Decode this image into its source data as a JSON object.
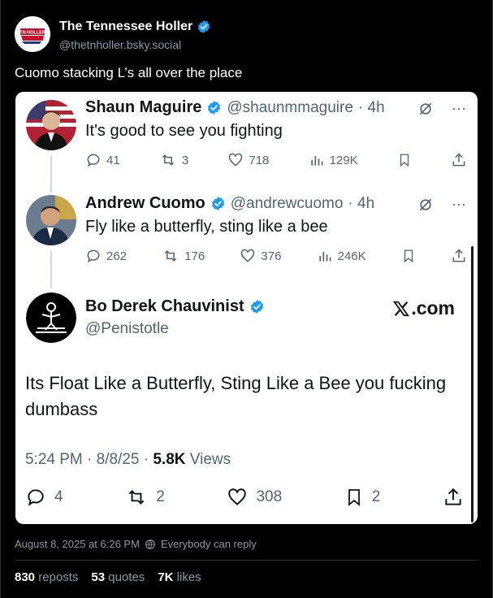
{
  "post": {
    "author_name": "The Tennessee Holler",
    "author_handle": "@thetnholler.bsky.social",
    "avatar_text": "TN HOLLER",
    "text": "Cuomo stacking L’s all over the place",
    "timestamp": "August 8, 2025 at 6:26 PM",
    "reply_setting": "Everybody can reply",
    "stats": {
      "reposts_count": "830",
      "reposts_label": "reposts",
      "quotes_count": "53",
      "quotes_label": "quotes",
      "likes_count": "7K",
      "likes_label": "likes"
    }
  },
  "screenshot": {
    "tweet1": {
      "name": "Shaun Maguire",
      "handle": "@shaunmmaguire",
      "time": "· 4h",
      "text": "It's good to see you fighting",
      "replies": "41",
      "reposts": "3",
      "likes": "718",
      "views": "129K"
    },
    "tweet2": {
      "name": "Andrew Cuomo",
      "handle": "@andrewcuomo",
      "time": "· 4h",
      "text": "Fly like a butterfly, sting like a bee",
      "replies": "262",
      "reposts": "176",
      "likes": "376",
      "views": "246K"
    },
    "quote": {
      "name": "Bo Derek Chauvinist",
      "handle": "@Penistotle",
      "site": ".com",
      "body": "Its Float Like a Butterfly, Sting Like a Bee you fucking dumbass",
      "time": "5:24 PM · 8/8/25 · ",
      "views_count": "5.8K",
      "views_label": " Views",
      "replies": "4",
      "reposts": "2",
      "likes": "308",
      "bookmarks": "2"
    }
  },
  "colors": {
    "verified": "#1d9bf0",
    "background": "#000000",
    "card": "#ffffff"
  }
}
